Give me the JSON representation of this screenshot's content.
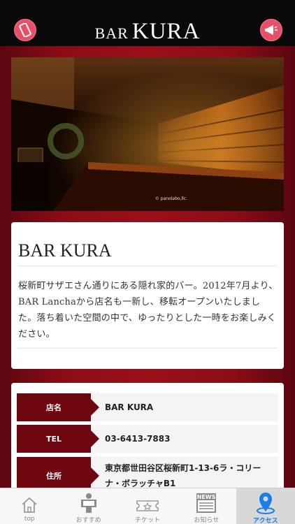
{
  "header": {
    "title_prefix": "BAR",
    "title_main": "KURA",
    "left_icon": "phone-icon",
    "right_icon": "megaphone-icon",
    "icon_bg": "#e8506a"
  },
  "hero": {
    "credit": "© panolabo,llc."
  },
  "intro": {
    "title": "BAR KURA",
    "text": "桜新町サザエさん通りにある隠れ家的バー。2012年7月より、BAR Lanchaから店名も一新し、移転オープンいたしました。落ち着いた空間の中で、ゆったりとした一時をお楽しみください。"
  },
  "details": {
    "rows": [
      {
        "label": "店名",
        "value": "BAR KURA"
      },
      {
        "label": "TEL",
        "value": "03-6413-7883"
      },
      {
        "label": "住所",
        "value": "東京都世田谷区桜新町1-13-6ラ・コリーナ・ボラッチャB1"
      }
    ],
    "label_color": "#6e0710"
  },
  "tabs": [
    {
      "label": "top",
      "icon": "home-icon"
    },
    {
      "label": "おすすめ",
      "icon": "recommend-icon"
    },
    {
      "label": "チケット",
      "icon": "ticket-icon"
    },
    {
      "label": "お知らせ",
      "icon": "news-icon"
    },
    {
      "label": "アクセス",
      "icon": "map-pin-icon",
      "active": true
    }
  ],
  "colors": {
    "background": "#8a0c17",
    "active_tab": "#1a7ee8"
  }
}
